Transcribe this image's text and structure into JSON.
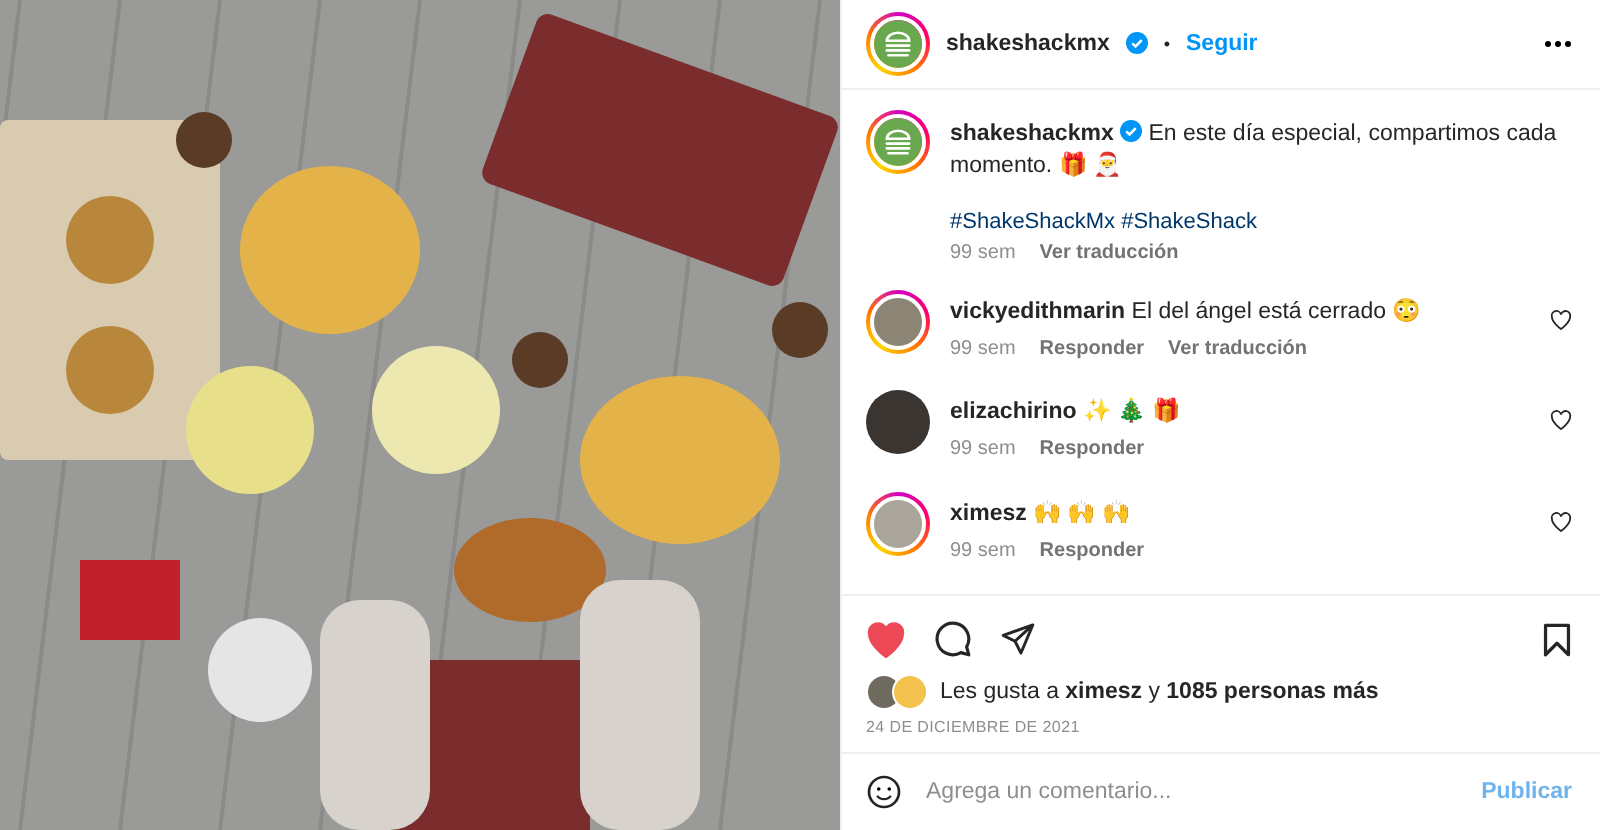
{
  "header": {
    "username": "shakeshackmx",
    "verified": true,
    "separator": "•",
    "follow": "Seguir",
    "story_ring": true
  },
  "caption": {
    "username": "shakeshackmx",
    "verified": true,
    "text": "En este día especial, compartimos cada momento. 🎁 🎅",
    "hashtags": "#ShakeShackMx #ShakeShack",
    "time": "99 sem",
    "translate": "Ver traducción",
    "story_ring": true
  },
  "comments": [
    {
      "username": "vickyedithmarin",
      "text": "El del ángel está cerrado 😳",
      "time": "99 sem",
      "reply": "Responder",
      "translate": "Ver traducción",
      "story_ring": true,
      "liked": false
    },
    {
      "username": "elizachirino",
      "text": "✨ 🎄 🎁",
      "time": "99 sem",
      "reply": "Responder",
      "story_ring": false,
      "liked": false
    },
    {
      "username": "ximesz",
      "text": "🙌 🙌 🙌",
      "time": "99 sem",
      "reply": "Responder",
      "story_ring": true,
      "liked": false
    }
  ],
  "actions": {
    "liked": true,
    "saved": false
  },
  "likes": {
    "text": "Les gusta a **ximesz** y **1085 personas más**"
  },
  "date": "24 DE DICIEMBRE DE 2021",
  "comment_field": {
    "placeholder": "Agrega un comentario...",
    "post": "Publicar",
    "post_disabled": true
  }
}
